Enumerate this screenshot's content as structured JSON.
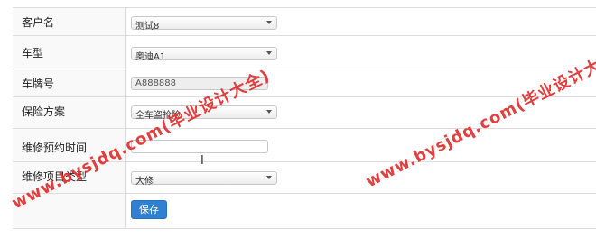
{
  "form": {
    "rows": [
      {
        "label": "客户名",
        "value": "测试8"
      },
      {
        "label": "车型",
        "value": "奥迪A1"
      },
      {
        "label": "车牌号",
        "value": "A888888"
      },
      {
        "label": "保险方案",
        "value": "全车盗抢险"
      },
      {
        "label": "维修预约时间",
        "value": ""
      },
      {
        "label": "维修项目类型",
        "value": "大修"
      }
    ],
    "save_label": "保存"
  },
  "watermark": {
    "text": "www.bysjdq.com(毕业设计大全)",
    "color": "#e03030"
  }
}
